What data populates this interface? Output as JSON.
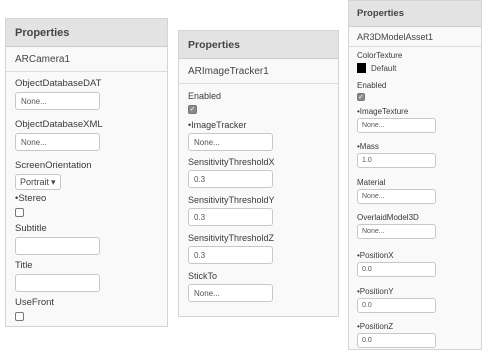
{
  "panel1": {
    "header": "Properties",
    "component": "ARCamera1",
    "props": {
      "object_database_dat": {
        "label": "ObjectDatabaseDAT",
        "value": "None..."
      },
      "object_database_xml": {
        "label": "ObjectDatabaseXML",
        "value": "None..."
      },
      "screen_orientation": {
        "label": "ScreenOrientation",
        "value": "Portrait",
        "arrow": "▾"
      },
      "stereo": {
        "label": "•Stereo",
        "checked": false
      },
      "subtitle": {
        "label": "Subtitle",
        "value": ""
      },
      "title": {
        "label": "Title",
        "value": ""
      },
      "use_front": {
        "label": "UseFront",
        "checked": false
      }
    }
  },
  "panel2": {
    "header": "Properties",
    "component": "ARImageTracker1",
    "props": {
      "enabled": {
        "label": "Enabled",
        "checked": true
      },
      "image_tracker": {
        "label": "•ImageTracker",
        "value": "None..."
      },
      "sensitivity_x": {
        "label": "SensitivityThresholdX",
        "value": "0.3"
      },
      "sensitivity_y": {
        "label": "SensitivityThresholdY",
        "value": "0.3"
      },
      "sensitivity_z": {
        "label": "SensitivityThresholdZ",
        "value": "0.3"
      },
      "stick_to": {
        "label": "StickTo",
        "value": "None..."
      }
    }
  },
  "panel3": {
    "header": "Properties",
    "component": "AR3DModelAsset1",
    "props": {
      "color_texture": {
        "label": "ColorTexture",
        "value": "Default",
        "swatch_color": "#000000"
      },
      "enabled": {
        "label": "Enabled",
        "checked": true
      },
      "image_texture": {
        "label": "•ImageTexture",
        "value": "None..."
      },
      "mass": {
        "label": "•Mass",
        "value": "1.0"
      },
      "material": {
        "label": "Material",
        "value": "None..."
      },
      "overlaid_model": {
        "label": "OverlaidModel3D",
        "value": "None..."
      },
      "position_x": {
        "label": "•PositionX",
        "value": "0.0"
      },
      "position_y": {
        "label": "•PositionY",
        "value": "0.0"
      },
      "position_z": {
        "label": "•PositionZ",
        "value": "0.0"
      }
    }
  },
  "colors": {
    "header_bg": "#e3e3e3",
    "panel_bg": "#f9f9f9",
    "checked_bg": "#8a8a8a"
  }
}
